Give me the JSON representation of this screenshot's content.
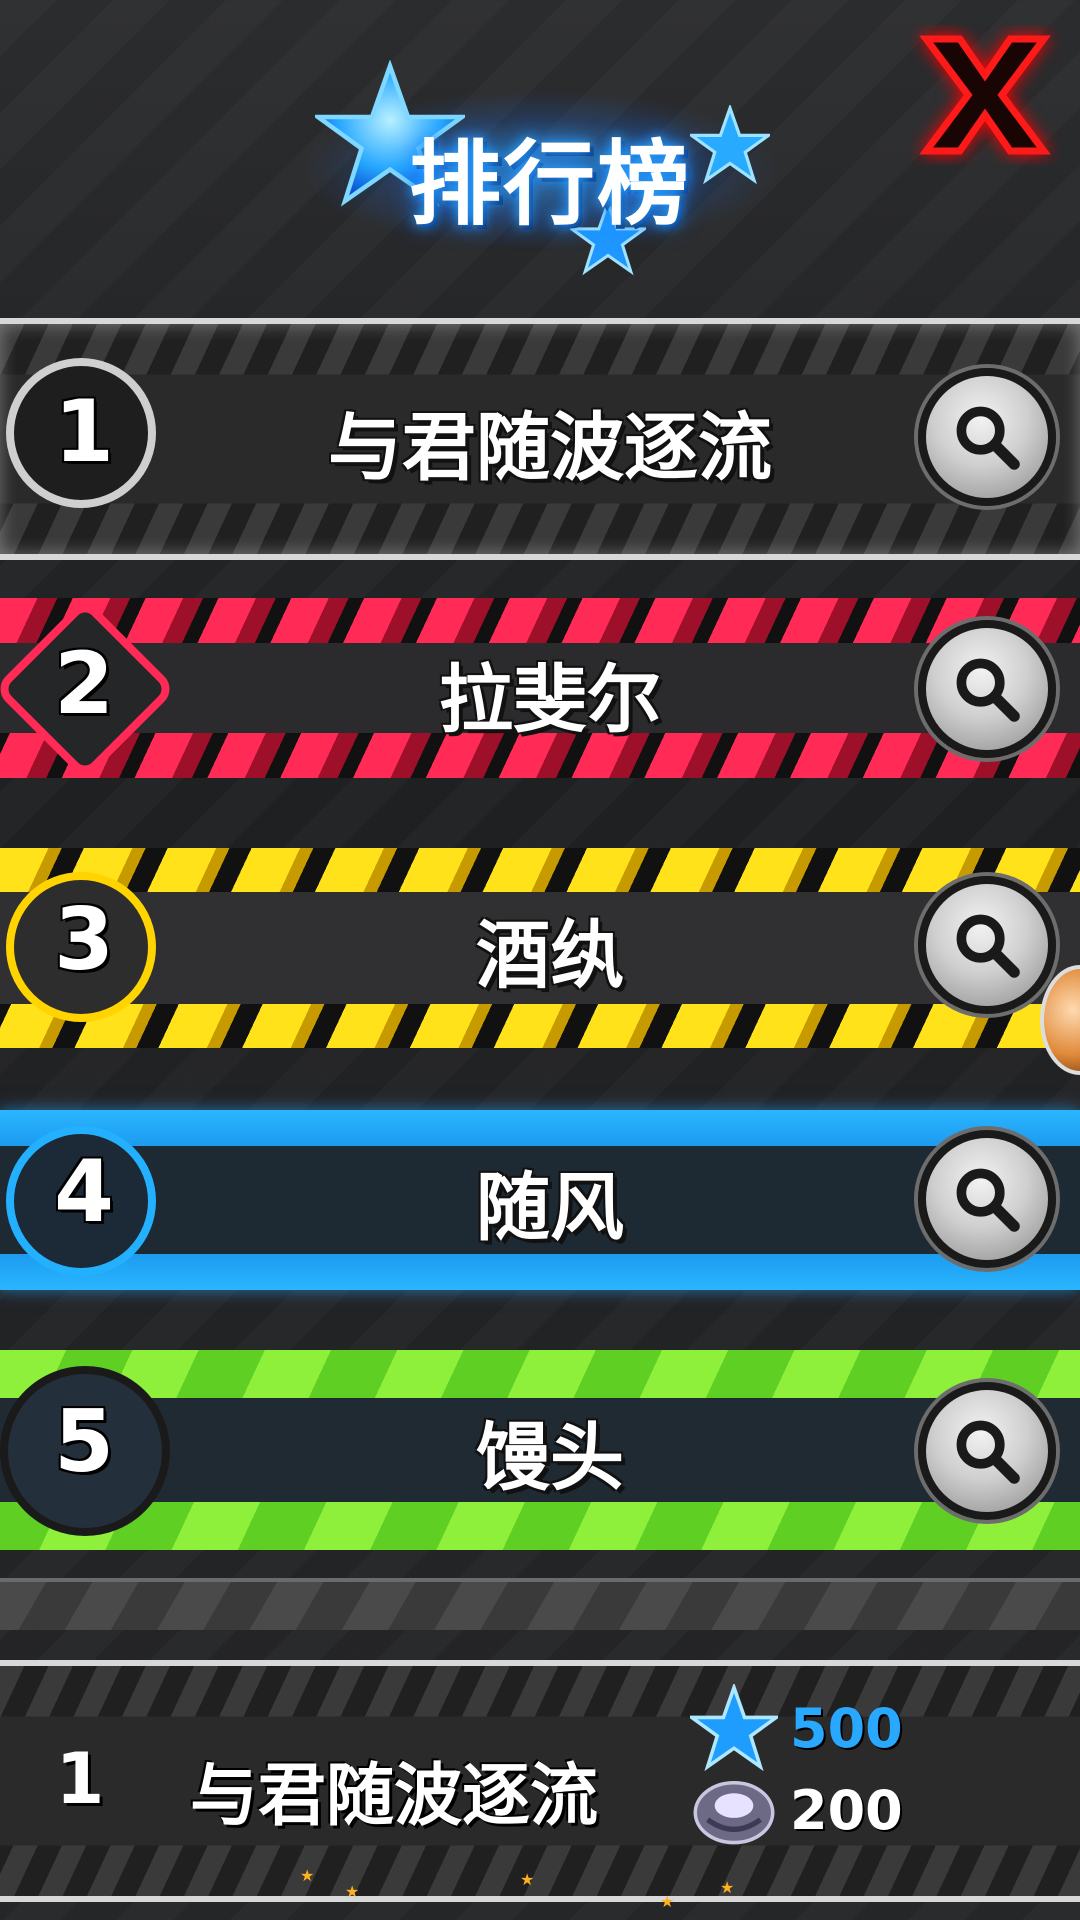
{
  "header": {
    "title": "排行榜",
    "close_icon": "close-x-icon"
  },
  "leaderboard": [
    {
      "rank": "1",
      "name": "与君随波逐流",
      "style": "silver",
      "action_icon": "magnifier-icon"
    },
    {
      "rank": "2",
      "name": "拉斐尔",
      "style": "red",
      "action_icon": "magnifier-icon"
    },
    {
      "rank": "3",
      "name": "酒纨",
      "style": "yellow",
      "action_icon": "magnifier-icon"
    },
    {
      "rank": "4",
      "name": "随风",
      "style": "blue",
      "action_icon": "magnifier-icon"
    },
    {
      "rank": "5",
      "name": "馒头",
      "style": "green",
      "action_icon": "magnifier-icon"
    }
  ],
  "my_entry": {
    "rank": "1",
    "name": "与君随波逐流",
    "stars": "500",
    "stones": "200",
    "stars_icon": "blue-star-icon",
    "stones_icon": "crystal-stone-icon"
  },
  "colors": {
    "title_glow": "#2aa8ff",
    "close": "#ff1a1a",
    "row_red": "#ff2a55",
    "row_yellow": "#ffe21a",
    "row_blue": "#29b6ff",
    "row_green": "#8ef03a",
    "stars_value": "#29a8ff"
  }
}
